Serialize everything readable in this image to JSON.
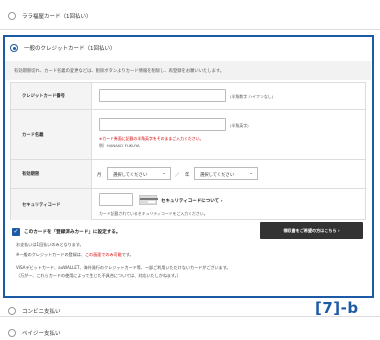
{
  "options": {
    "top_label": "ララ福屋カード（1回払い）",
    "selected_label": "一般のクレジットカード（1回払い）",
    "conveni_label": "コンビニ支払い",
    "paypay_label": "ペイジー支払い"
  },
  "notice": "有効期限切れ、カード名義の変更などは、削除ボタンよりカード情報を削除し、再登録をお願いいたします。",
  "form": {
    "card_number": {
      "label": "クレジットカード番号",
      "hint": "(半角数字 ハイフンなし)"
    },
    "card_name": {
      "label": "カード名義",
      "hint": "(半角英字)",
      "warning": "※カード券面に記載の半角英字をそのままご入力ください。",
      "example": "例）HANAKO FUKUYA"
    },
    "expiry": {
      "label": "有効期限",
      "month_unit": "月",
      "year_unit": "年",
      "month_placeholder": "選択してください",
      "year_placeholder": "選択してください",
      "separator": "／"
    },
    "security": {
      "label": "セキュリティコード",
      "link": "セキュリティコードについて",
      "hint": "カード記載されているセキュリティコードをご入力ください。"
    }
  },
  "register": {
    "label": "このカードを「登録済みカード」に設定する。",
    "button": "領収書をご希望の方はこちら"
  },
  "notes": [
    "お支払いは1回払いのみとなります。",
    "※一般のクレジットカードの登録は、",
    "この画面でのみ可能",
    "です。",
    "VISAデビットカード、auWALLET、海外発行のクレジットカード等、一部ご利用いただけないカードがございます。",
    "（万が一、これらカードの使用によって生じた不具合については、対応いたしかねます。）"
  ],
  "figure_label": "[7]-b",
  "colors": {
    "accent": "#1c5aa6",
    "warning": "#d40000",
    "button_dark": "#333333"
  }
}
